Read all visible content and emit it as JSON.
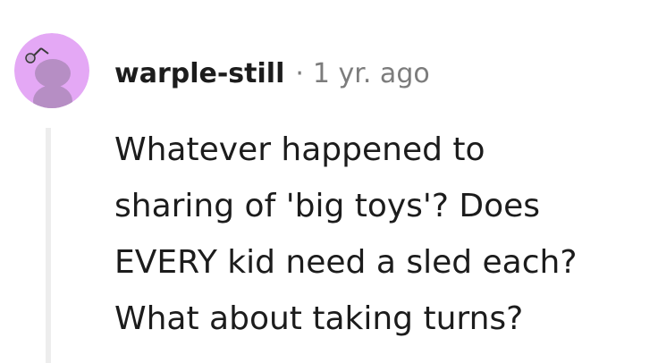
{
  "comment": {
    "avatar_icon": "snoo-avatar-icon",
    "avatar_color": "#e4a8f5",
    "username": "warple-still",
    "separator": "·",
    "timestamp": "1 yr. ago",
    "body_lines": [
      "Whatever happened to",
      "sharing of 'big toys'? Does",
      "EVERY kid need a sled each?",
      "What about taking turns?"
    ]
  }
}
